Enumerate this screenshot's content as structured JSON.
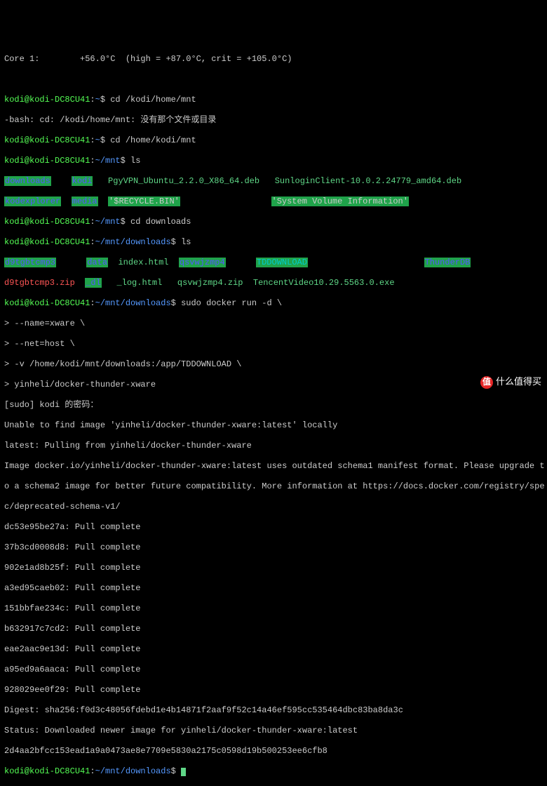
{
  "sensors": {
    "core": "Core 1:        +56.0°C  (high = +87.0°C, crit = +105.0°C)"
  },
  "prompt": {
    "user": "kodi@kodi-DC8CU41",
    "home": "~",
    "mnt": "~/mnt",
    "dl": "~/mnt/downloads"
  },
  "cmds": {
    "cd1": "cd /kodi/home/mnt",
    "err1": "-bash: cd: /kodi/home/mnt: 没有那个文件或目录",
    "cd2": "cd /home/kodi/mnt",
    "ls1": "ls",
    "cd3": "cd downloads",
    "ls2": "ls",
    "docker": "sudo docker run -d \\",
    "d1": "> --name=xware \\",
    "d2": "> --net=host \\",
    "d3": "> -v /home/kodi/mnt/downloads:/app/TDDOWNLOAD \\",
    "d4": "> yinheli/docker-thunder-xware"
  },
  "ls_mnt": {
    "downloads": "downloads",
    "kodi": "kodi",
    "pgy": "PgyVPN_Ubuntu_2.2.0_X86_64.deb",
    "sunlogin": "SunloginClient-10.0.2.24779_amd64.deb",
    "kodexplorer": "kodexplorer",
    "media": "media",
    "recycle": "'$RECYCLE.BIN'",
    "svi": "'System Volume Information'"
  },
  "ls_dl": {
    "d9": "d9tgbtcmp3",
    "data": "data",
    "index": "index.html",
    "qsv": "qsvwjzmp4",
    "tdd": "TDDOWNLOAD",
    "thunderdb": "ThunderDB",
    "d9zip": "d9tgbtcmp3.zip",
    "dl": "_dl",
    "log": "_log.html",
    "qsvzip": "qsvwjzmp4.zip",
    "tencent": "TencentVideo10.29.5563.0.exe"
  },
  "docker_out": {
    "sudo": "[sudo] kodi 的密码：",
    "unable": "Unable to find image 'yinheli/docker-thunder-xware:latest' locally",
    "latest": "latest: Pulling from yinheli/docker-thunder-xware",
    "warn1": "Image docker.io/yinheli/docker-thunder-xware:latest uses outdated schema1 manifest format. Please upgrade t",
    "warn2": "o a schema2 image for better future compatibility. More information at https://docs.docker.com/registry/spe",
    "warn3": "c/deprecated-schema-v1/",
    "p1": "dc53e95be27a: Pull complete",
    "p2": "37b3cd0008d8: Pull complete",
    "p3": "902e1ad8b25f: Pull complete",
    "p4": "a3ed95caeb02: Pull complete",
    "p5": "151bbfae234c: Pull complete",
    "p6": "b632917c7cd2: Pull complete",
    "p7": "eae2aac9e13d: Pull complete",
    "p8": "a95ed9a6aaca: Pull complete",
    "p9": "928029ee0f29: Pull complete",
    "digest": "Digest: sha256:f0d3c48056fdebd1e4b14871f2aaf9f52c14a46ef595cc535464dbc83ba8da3c",
    "status": "Status: Downloaded newer image for yinheli/docker-thunder-xware:latest",
    "id": "2d4aa2bfcc153ead1a9a0473ae8e7709e5830a2175c0598d19b500253ee6cfb8"
  },
  "watermark": {
    "badge": "值",
    "text": "什么值得买"
  }
}
